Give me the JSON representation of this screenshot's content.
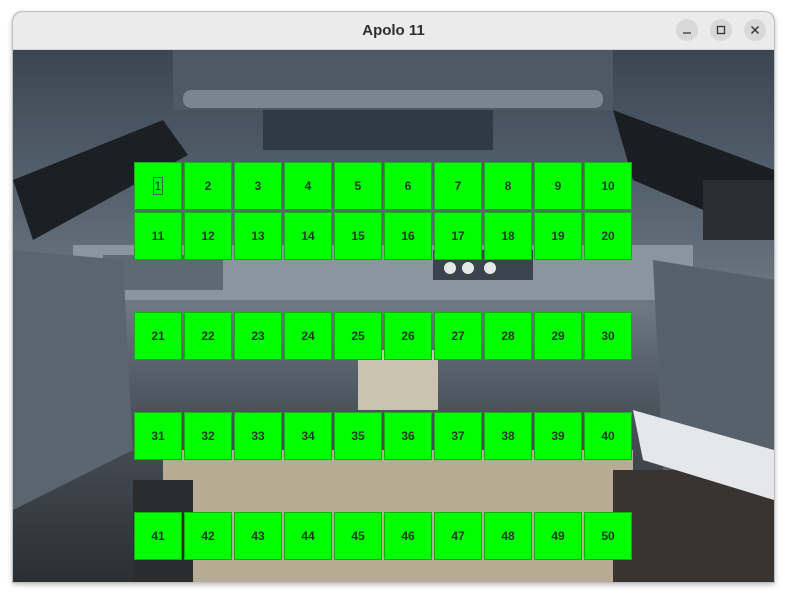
{
  "window": {
    "title": "Apolo 11",
    "controls": [
      "minimize-icon",
      "maximize-icon",
      "close-icon"
    ]
  },
  "colors": {
    "button_green": "#00ff00",
    "titlebar": "#ebebeb"
  },
  "grid": {
    "rows": [
      [
        "1",
        "2",
        "3",
        "4",
        "5",
        "6",
        "7",
        "8",
        "9",
        "10"
      ],
      [
        "11",
        "12",
        "13",
        "14",
        "15",
        "16",
        "17",
        "18",
        "19",
        "20"
      ],
      [
        "21",
        "22",
        "23",
        "24",
        "25",
        "26",
        "27",
        "28",
        "29",
        "30"
      ],
      [
        "31",
        "32",
        "33",
        "34",
        "35",
        "36",
        "37",
        "38",
        "39",
        "40"
      ],
      [
        "41",
        "42",
        "43",
        "44",
        "45",
        "46",
        "47",
        "48",
        "49",
        "50"
      ]
    ],
    "focused": "1"
  }
}
